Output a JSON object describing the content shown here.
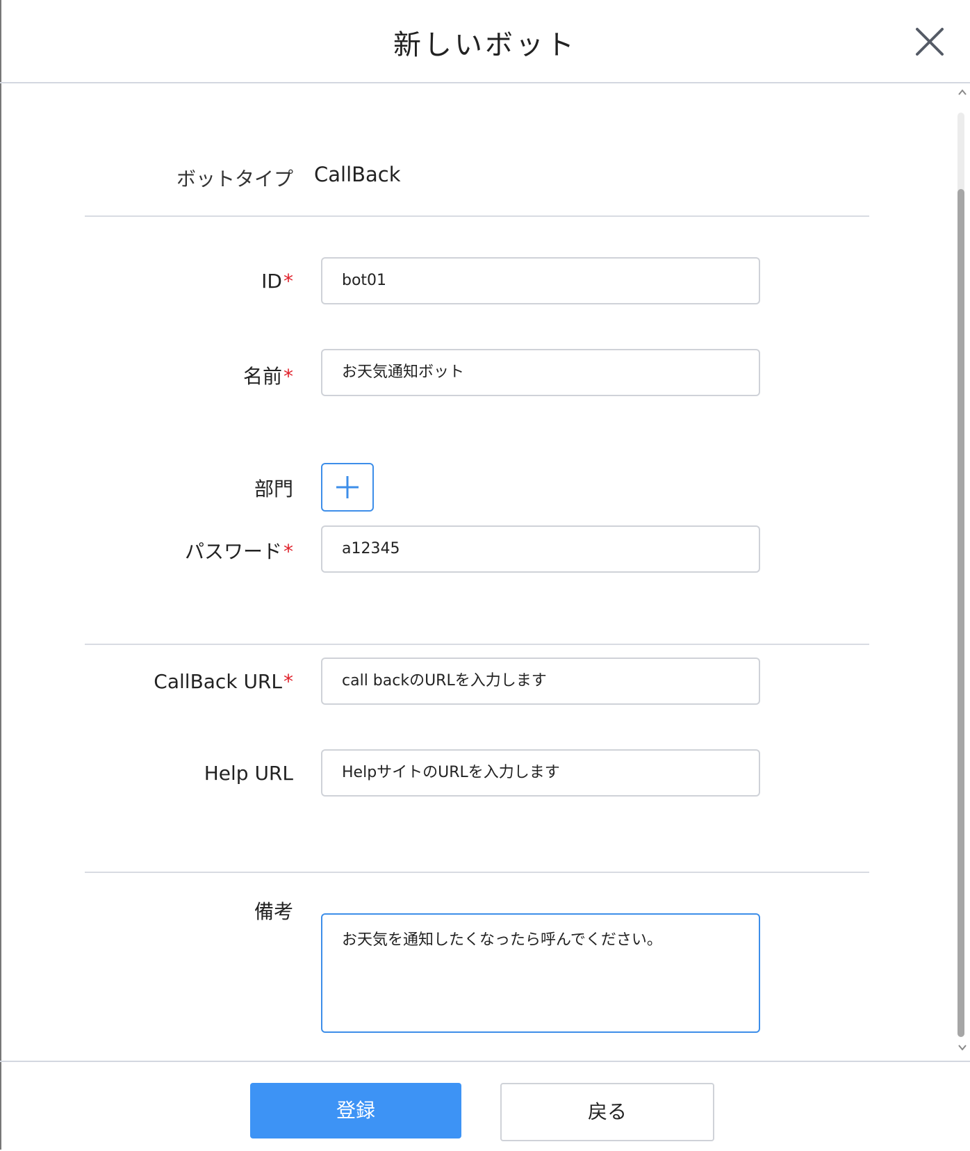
{
  "dialog": {
    "title": "新しいボット",
    "close_icon": "close-icon"
  },
  "form": {
    "bot_type": {
      "label": "ボットタイプ",
      "value": "CallBack"
    },
    "id": {
      "label": "ID",
      "required_mark": "*",
      "value": "bot01"
    },
    "name": {
      "label": "名前",
      "required_mark": "*",
      "value": "お天気通知ボット"
    },
    "department": {
      "label": "部門",
      "add_icon": "plus-icon"
    },
    "password": {
      "label": "パスワード",
      "required_mark": "*",
      "value": "a12345"
    },
    "callback_url": {
      "label": "CallBack URL",
      "required_mark": "*",
      "placeholder": "call backのURLを入力します"
    },
    "help_url": {
      "label": "Help URL",
      "placeholder": "HelpサイトのURLを入力します"
    },
    "notes": {
      "label": "備考",
      "value": "お天気を通知したくなったら呼んでください。"
    }
  },
  "footer": {
    "submit_label": "登録",
    "back_label": "戻る"
  },
  "colors": {
    "primary": "#3d93f5",
    "required": "#e0212b",
    "focus_border": "#3d8ee9"
  }
}
